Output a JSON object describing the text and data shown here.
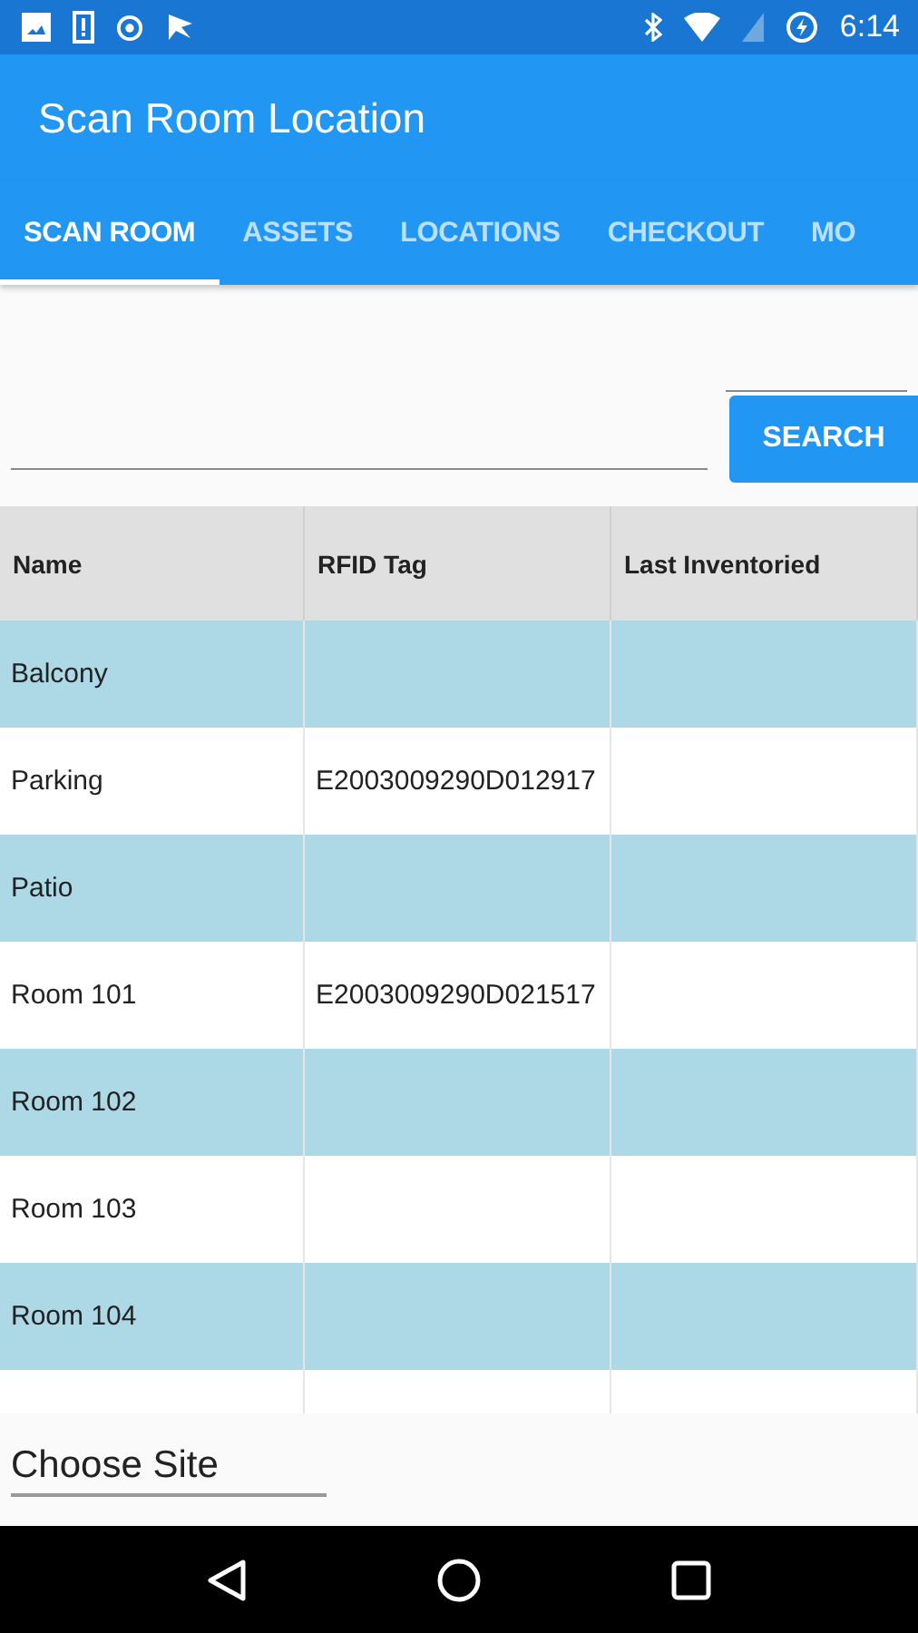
{
  "status_bar": {
    "time": "6:14"
  },
  "app_bar": {
    "title": "Scan Room Location"
  },
  "tabs": [
    {
      "label": "SCAN ROOM",
      "selected": true
    },
    {
      "label": "ASSETS",
      "selected": false
    },
    {
      "label": "LOCATIONS",
      "selected": false
    },
    {
      "label": "CHECKOUT",
      "selected": false
    },
    {
      "label": "MO",
      "selected": false
    }
  ],
  "search": {
    "button": "SEARCH"
  },
  "table": {
    "columns": [
      "Name",
      "RFID Tag",
      "Last Inventoried"
    ],
    "rows": [
      [
        "Balcony",
        "",
        ""
      ],
      [
        "Parking",
        "E2003009290D012917",
        ""
      ],
      [
        "Patio",
        "",
        ""
      ],
      [
        "Room 101",
        "E2003009290D021517",
        ""
      ],
      [
        "Room 102",
        "",
        ""
      ],
      [
        "Room 103",
        "",
        ""
      ],
      [
        "Room 104",
        "",
        ""
      ],
      [
        "",
        "",
        ""
      ]
    ]
  },
  "site_picker": {
    "value": "Choose Site"
  }
}
